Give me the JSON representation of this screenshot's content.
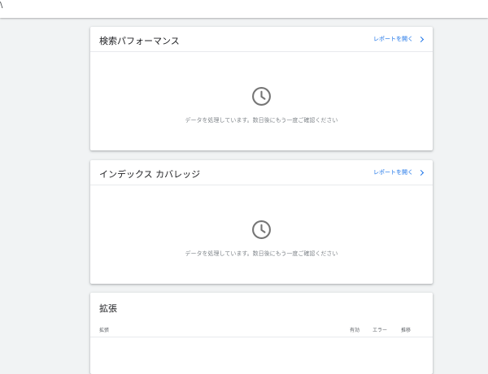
{
  "topbar": {
    "glyph": "\\"
  },
  "cards": {
    "performance": {
      "title": "検索パフォーマンス",
      "link_label": "レポートを開く",
      "message": "データを処理しています。数日後にもう一度ご確認ください",
      "icon": "clock-icon"
    },
    "index_coverage": {
      "title": "インデックス カバレッジ",
      "link_label": "レポートを開く",
      "message": "データを処理しています。数日後にもう一度ご確認ください",
      "icon": "clock-icon"
    },
    "extensions": {
      "title": "拡張",
      "columns": {
        "name": "拡張",
        "valid": "有効",
        "error": "エラー",
        "trend": "推移"
      }
    }
  },
  "colors": {
    "background": "#f1f3f4",
    "link": "#1a73e8",
    "icon": "#757575",
    "muted_text": "#80868b"
  }
}
